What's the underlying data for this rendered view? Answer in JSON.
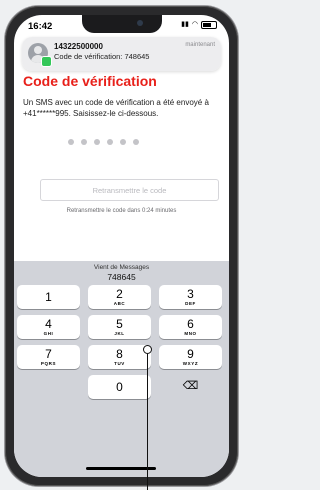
{
  "status": {
    "time": "16:42"
  },
  "notification": {
    "sender": "14322500000",
    "message": "Code de vérification: 748645",
    "time": "maintenant"
  },
  "page": {
    "title": "Code de vérification",
    "description": "Un SMS avec un code de vérification a été envoyé à +41******995. Saisissez-le ci-dessous.",
    "code_dots": 6,
    "resend_button": "Retransmettre le code",
    "resend_timer": "Retransmettre le code dans 0:24 minutes"
  },
  "keyboard": {
    "suggestion_source": "Vient de Messages",
    "suggestion_code": "748645",
    "keys": [
      {
        "num": "1",
        "letters": ""
      },
      {
        "num": "2",
        "letters": "ABC"
      },
      {
        "num": "3",
        "letters": "DEF"
      },
      {
        "num": "4",
        "letters": "GHI"
      },
      {
        "num": "5",
        "letters": "JKL"
      },
      {
        "num": "6",
        "letters": "MNO"
      },
      {
        "num": "7",
        "letters": "PQRS"
      },
      {
        "num": "8",
        "letters": "TUV"
      },
      {
        "num": "9",
        "letters": "WXYZ"
      },
      {
        "num": "0",
        "letters": ""
      }
    ],
    "backspace_glyph": "⌫"
  },
  "colors": {
    "accent": "#e8201a",
    "keyboard_bg": "#d1d3d9",
    "badge": "#34c759"
  }
}
